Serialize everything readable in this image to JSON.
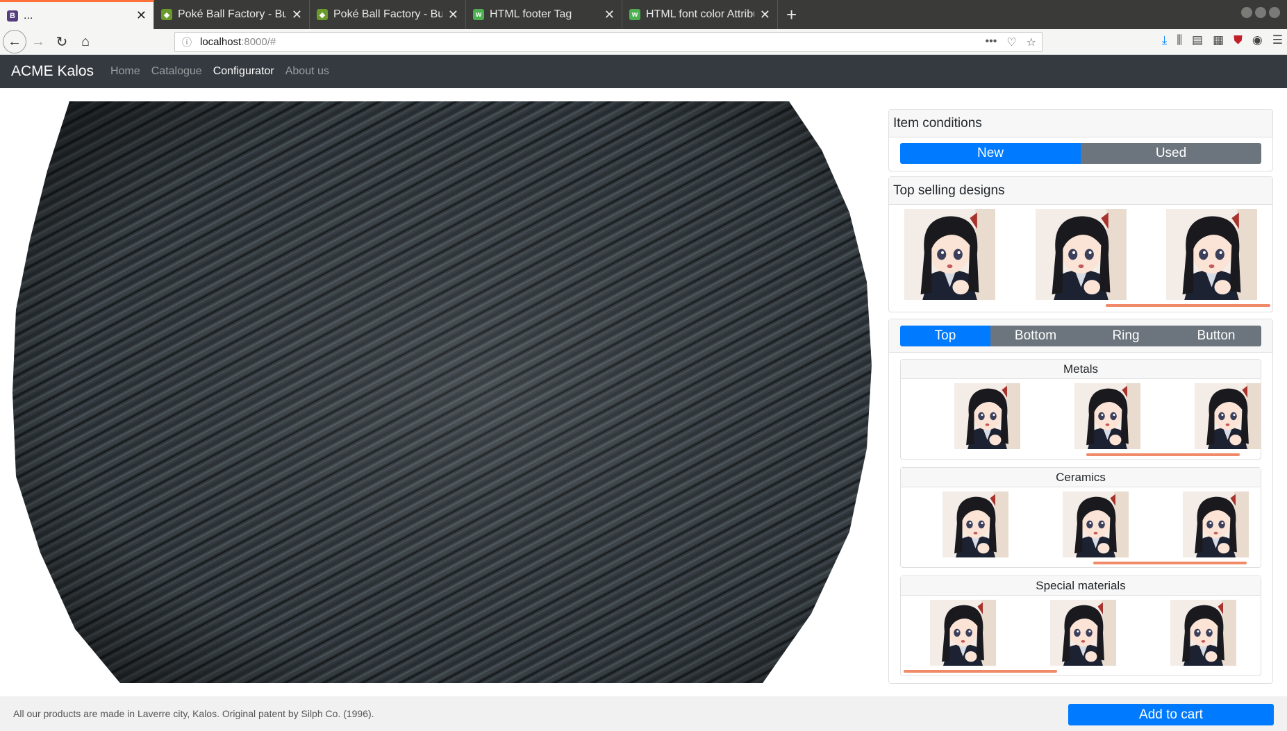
{
  "browser": {
    "tabs": [
      {
        "title": "...",
        "favicon": "B",
        "fav_color": "#563d7c",
        "active": true
      },
      {
        "title": "Poké Ball Factory - Bulba",
        "favicon": "leaf",
        "fav_color": "#6a9a2a",
        "active": false
      },
      {
        "title": "Poké Ball Factory - Bulba",
        "favicon": "leaf",
        "fav_color": "#6a9a2a",
        "active": false
      },
      {
        "title": "HTML footer Tag",
        "favicon": "w3",
        "fav_color": "#4caf50",
        "active": false
      },
      {
        "title": "HTML font color Attribu",
        "favicon": "w3",
        "fav_color": "#4caf50",
        "active": false
      }
    ],
    "url_host": "localhost",
    "url_path": ":8000/#"
  },
  "site": {
    "brand": "ACME Kalos",
    "nav": [
      {
        "label": "Home",
        "active": false
      },
      {
        "label": "Catalogue",
        "active": false
      },
      {
        "label": "Configurator",
        "active": true
      },
      {
        "label": "About us",
        "active": false
      }
    ]
  },
  "conditions": {
    "header": "Item conditions",
    "options": [
      {
        "label": "New",
        "active": true
      },
      {
        "label": "Used",
        "active": false
      }
    ]
  },
  "top_selling": {
    "header": "Top selling designs"
  },
  "parts": {
    "tabs": [
      {
        "label": "Top",
        "active": true
      },
      {
        "label": "Bottom",
        "active": false
      },
      {
        "label": "Ring",
        "active": false
      },
      {
        "label": "Button",
        "active": false
      }
    ],
    "materials": [
      {
        "title": "Metals"
      },
      {
        "title": "Ceramics"
      },
      {
        "title": "Special materials"
      }
    ]
  },
  "footer": {
    "text": "All our products are made in Laverre city, Kalos. Original patent by Silph Co. (1996).",
    "cart_label": "Add to cart"
  }
}
